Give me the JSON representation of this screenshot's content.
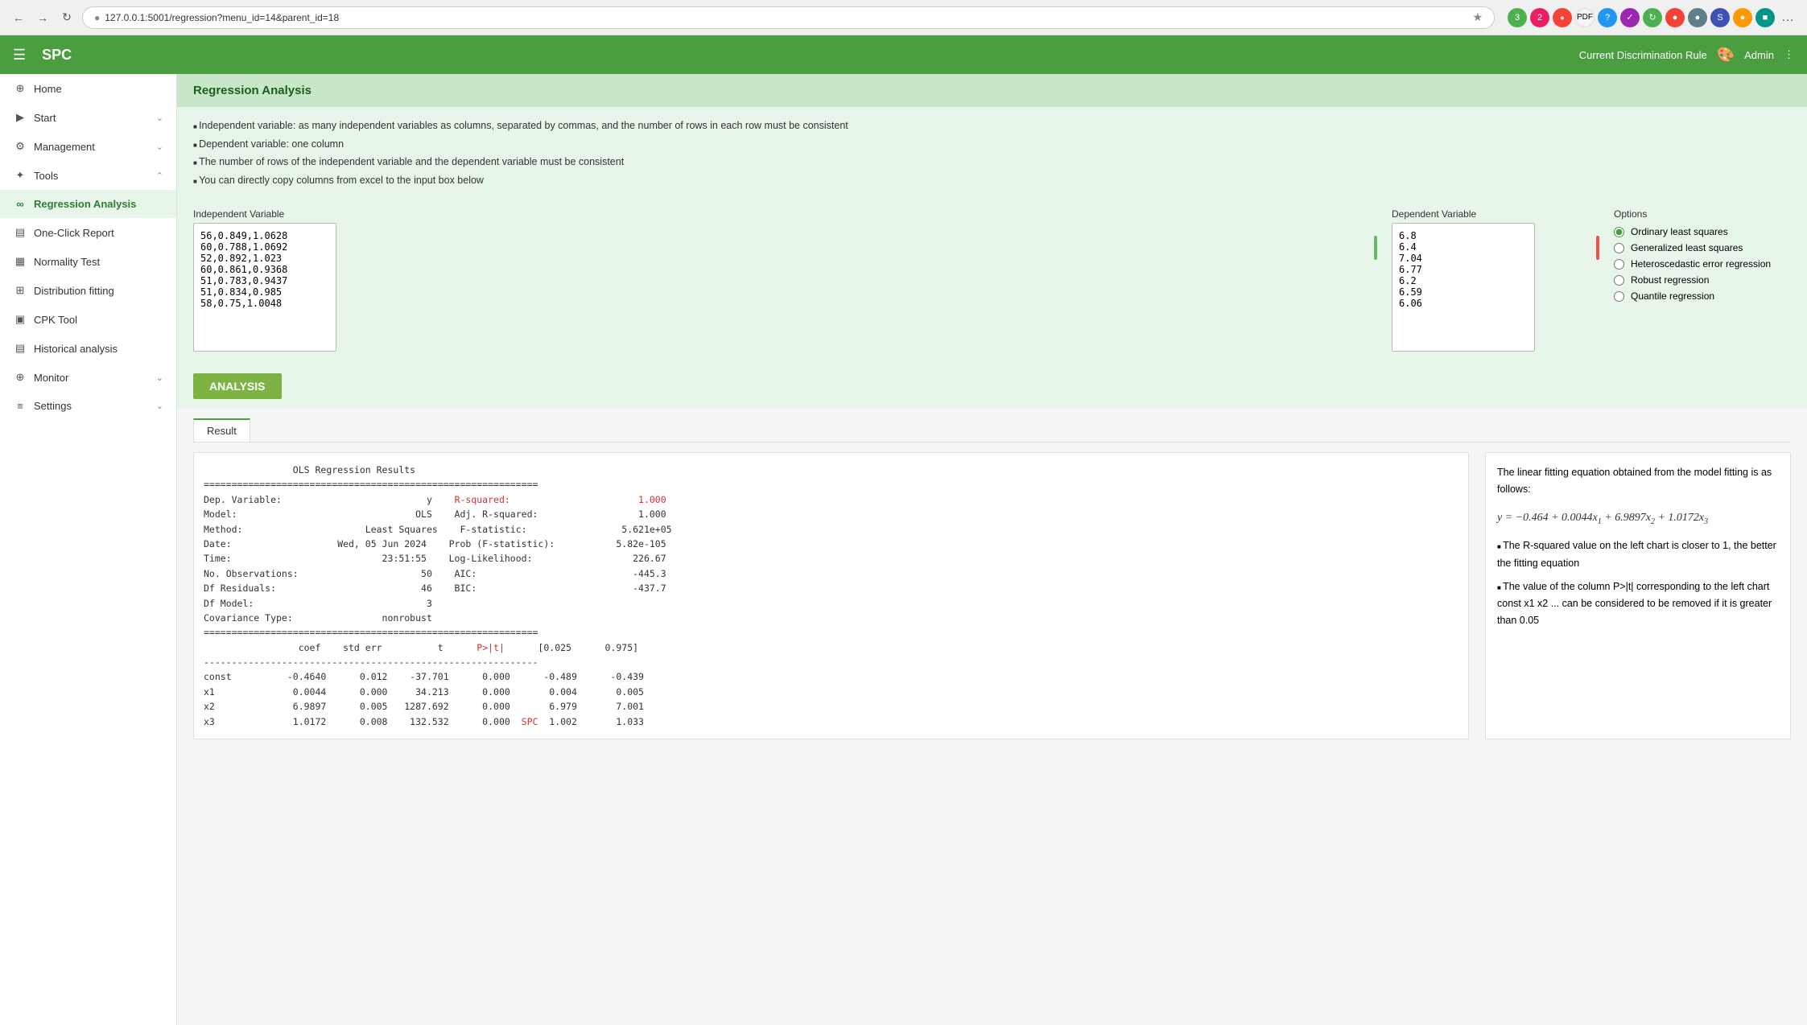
{
  "browser": {
    "url": "127.0.0.1:5001/regression?menu_id=14&parent_id=18",
    "back_btn": "←",
    "forward_btn": "→",
    "refresh_btn": "↺"
  },
  "topnav": {
    "menu_icon": "☰",
    "title": "SPC",
    "discrimination_rule": "Current Discrimination Rule",
    "admin": "Admin"
  },
  "sidebar": {
    "items": [
      {
        "id": "home",
        "label": "Home",
        "icon": "⊕",
        "has_arrow": false
      },
      {
        "id": "start",
        "label": "Start",
        "icon": "▷",
        "has_arrow": true
      },
      {
        "id": "management",
        "label": "Management",
        "icon": "⚙",
        "has_arrow": true
      },
      {
        "id": "tools",
        "label": "Tools",
        "icon": "✦",
        "has_arrow": true,
        "expanded": true
      },
      {
        "id": "regression-analysis",
        "label": "Regression Analysis",
        "icon": "∞",
        "active": true
      },
      {
        "id": "one-click-report",
        "label": "One-Click Report",
        "icon": "▤"
      },
      {
        "id": "normality-test",
        "label": "Normality Test",
        "icon": "▦"
      },
      {
        "id": "distribution-fitting",
        "label": "Distribution fitting",
        "icon": "⊞"
      },
      {
        "id": "cpk-tool",
        "label": "CPK Tool",
        "icon": "▣"
      },
      {
        "id": "historical-analysis",
        "label": "Historical analysis",
        "icon": "▤"
      },
      {
        "id": "monitor",
        "label": "Monitor",
        "icon": "⊕",
        "has_arrow": true
      },
      {
        "id": "settings",
        "label": "Settings",
        "icon": "≡",
        "has_arrow": true
      }
    ]
  },
  "page": {
    "title": "Regression Analysis",
    "info_items": [
      "Independent variable: as many independent variables as columns, separated by commas, and the number of rows in each row must be consistent",
      "Dependent variable: one column",
      "The number of rows of the independent variable and the dependent variable must be consistent",
      "You can directly copy columns from excel to the input box below"
    ],
    "independent_variable_label": "Independent Variable",
    "dependent_variable_label": "Dependent Variable",
    "independent_variable_data": "56,0.849,1.0628\n60,0.788,1.0692\n52,0.892,1.023\n60,0.861,0.9368\n51,0.783,0.9437\n51,0.834,0.985\n58,0.75,1.0048",
    "dependent_variable_data": "6.8\n6.4\n7.04\n6.77\n6.2\n6.59\n6.06",
    "options_label": "Options",
    "options": [
      {
        "id": "ols",
        "label": "Ordinary least squares",
        "selected": true
      },
      {
        "id": "gls",
        "label": "Generalized least squares",
        "selected": false
      },
      {
        "id": "her",
        "label": "Heteroscedastic error regression",
        "selected": false
      },
      {
        "id": "robust",
        "label": "Robust regression",
        "selected": false
      },
      {
        "id": "quantile",
        "label": "Quantile regression",
        "selected": false
      }
    ],
    "analysis_button": "ANALYSIS",
    "result_tab": "Result",
    "ols_results_title": "OLS Regression Results",
    "result_lines": [
      "============================================================",
      "Dep. Variable:                          y    R-squared:                       1.000",
      "Model:                                OLS    Adj. R-squared:                  1.000",
      "Method:                      Least Squares    F-statistic:                 5.621e+05",
      "Date:                   Wed, 05 Jun 2024    Prob (F-statistic):           5.82e-105",
      "Time:                           23:51:55    Log-Likelihood:                  226.67",
      "No. Observations:                      50    AIC:                            -445.3",
      "Df Residuals:                          46    BIC:                            -437.7",
      "Df Model:                               3",
      "Covariance Type:                nonrobust",
      "============================================================",
      "                 coef    std err          t      P>|t|      [0.025      0.975]",
      "------------------------------------------------------------",
      "const          -0.4640      0.012    -37.701      0.000      -0.489      -0.439",
      "x1              0.0044      0.000     34.213      0.000       0.004       0.005",
      "x2              6.9897      0.005   1287.692      0.000       6.979       7.001",
      "x3              1.0172      0.008    132.532      0.000  SPC  1.002       1.033"
    ],
    "r_squared_label": "R-squared:",
    "adj_r_squared_label": "Adj. R-squared:",
    "p_label": "P>|t|",
    "info_title": "The linear fitting equation obtained from the model fitting is as follows:",
    "equation": "y = −0.464 + 0.0044x₁ + 6.9897x₂ + 1.0172x₃",
    "info_bullets": [
      "The R-squared value on the left chart is closer to 1, the better the fitting equation",
      "The value of the column P>|t| corresponding to the left chart const x1 x2 ... can be considered to be removed if it is greater than 0.05"
    ]
  }
}
